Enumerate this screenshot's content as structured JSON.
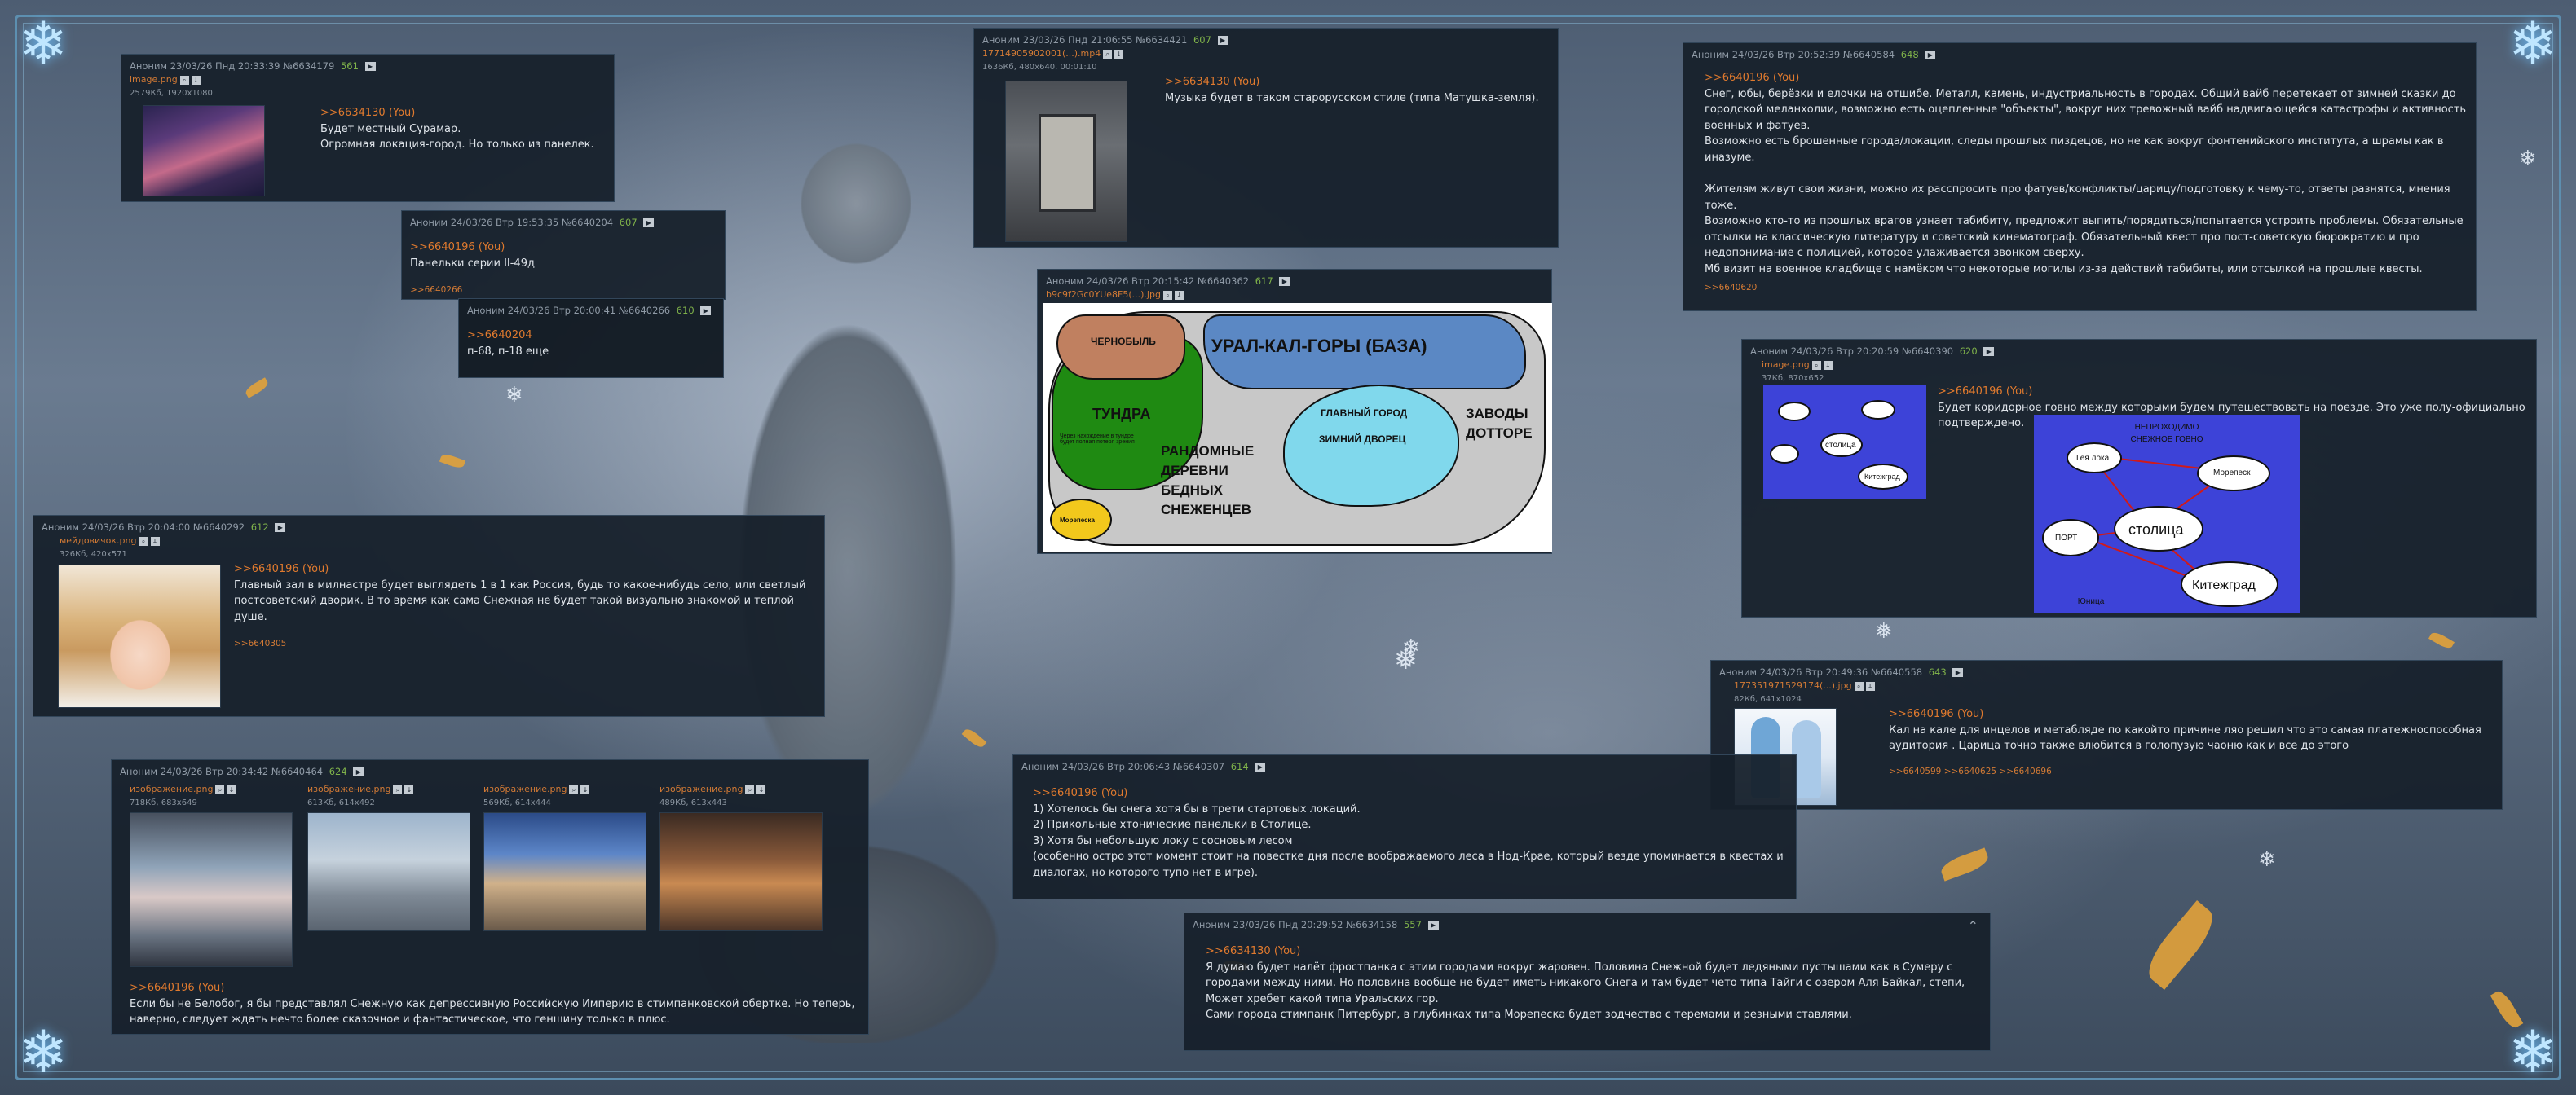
{
  "posts": {
    "p1": {
      "header": "Аноним 23/03/26 Пнд 20:33:39 №6634179",
      "count": "561",
      "file_name": "image.png",
      "file_meta": "2579Кб, 1920x1080",
      "reply_to": ">>6634130 (You)",
      "lines": [
        "Будет местный Сурамар.",
        "Огромная локация-город. Но только из панелек."
      ]
    },
    "p2": {
      "header": "Аноним 24/03/26 Втр 19:53:35 №6640204",
      "count": "607",
      "reply_to": ">>6640196 (You)",
      "lines": [
        "Панельки серии II-49д"
      ],
      "backrefs": ">>6640266"
    },
    "p3": {
      "header": "Аноним 24/03/26 Втр 20:00:41 №6640266",
      "count": "610",
      "reply_to": ">>6640204",
      "lines": [
        "п-68, п-18 еще"
      ]
    },
    "p4": {
      "header": "Аноним 23/03/26 Пнд 21:06:55 №6634421",
      "count": "607",
      "file_name": "17714905902001(...).mp4",
      "file_meta": "1636Кб, 480x640, 00:01:10",
      "reply_to": ">>6634130 (You)",
      "lines": [
        "Музыка будет в таком старорусском стиле (типа Матушка-земля)."
      ]
    },
    "p5": {
      "header": "Аноним 24/03/26 Втр 20:15:42 №6640362",
      "count": "617",
      "file_name": "b9c9f2Gc0YUe8F5(...).jpg",
      "map": {
        "chernobyl": "ЧЕРНОБЫЛЬ",
        "ural": "УРАЛ-КАЛ-ГОРЫ (БАЗА)",
        "tundra": "ТУНДРА",
        "tundra_note": "Через нахождение в тундре будет полная потеря зрения",
        "villages": [
          "РАНДОМНЫЕ",
          "ДЕРЕВНИ",
          "БЕДНЫХ",
          "СНЕЖЕНЦЕВ"
        ],
        "capital": "ГЛАВНЫЙ ГОРОД",
        "palace": "ЗИМНИЙ ДВОРЕЦ",
        "factories": [
          "ЗАВОДЫ",
          "ДОТТОРЕ"
        ],
        "morepeska": "Морепеска"
      }
    },
    "p6": {
      "header": "Аноним 24/03/26 Втр 20:52:39 №6640584",
      "count": "648",
      "reply_to": ">>6640196 (You)",
      "paragraphs": [
        "Снег, юбы, берёзки и елочки на отшибе. Металл, камень, индустриальность в городах. Общий вайб перетекает от зимней сказки до городской меланхолии, возможно есть оцепленные \"объекты\", вокруг них тревожный вайб надвигающейся катастрофы и активность военных и фатуев.",
        "Возможно есть брошенные города/локации, следы прошлых пиздецов, но не как вокруг фонтенийского института, а шрамы как в иназуме.",
        "",
        "Жителям живут свои жизни, можно их расспросить про фатуев/конфликты/царицу/подготовку к чему-то, ответы разнятся, мнения тоже.",
        "Возможно кто-то из прошлых врагов узнает табибиту, предложит выпить/порядиться/попытается устроить проблемы. Обязательные отсылки на классическую литературу и советский кинематограф. Обязательный квест про пост-советскую бюрократию и про недопонимание с полицией, которое улаживается звонком сверху.",
        "Мб визит на военное кладбище с намёком что некоторые могилы из-за действий табибиты, или отсылкой на прошлые квесты."
      ],
      "backrefs": ">>6640620"
    },
    "p7": {
      "header": "Аноним 24/03/26 Втр 20:20:59 №6640390",
      "count": "620",
      "file_name": "image.png",
      "file_meta": "37Кб, 870x652",
      "reply_to": ">>6640196 (You)",
      "lines": [
        "Будет коридорное говно между которыми будем путешествовать на поезде. Это уже полу-официально подтверждено."
      ],
      "route": {
        "top_note": "НЕПРОХОДИМО СНЕЖНОЕ ГОВНО",
        "cities": [
          "Гея лока",
          "Морепеск",
          "столица",
          "ПОРТ",
          "Китежград"
        ],
        "bottom_note": "Юница"
      }
    },
    "p8": {
      "header": "Аноним 24/03/26 Втр 20:04:00 №6640292",
      "count": "612",
      "file_name": "мейдовичок.png",
      "file_meta": "326Кб, 420x571",
      "reply_to": ">>6640196 (You)",
      "lines": [
        "Главный зал в милнастре будет выглядеть 1 в 1 как Россия, будь то какое-нибудь село, или светлый постсоветский дворик. В то время как сама Снежная не будет такой визуально знакомой и теплой душе."
      ],
      "backrefs": ">>6640305"
    },
    "p9": {
      "header": "Аноним 24/03/26 Втр 20:49:36 №6640558",
      "count": "643",
      "file_name": "177351971529174(...).jpg",
      "file_meta": "82Кб, 641x1024",
      "reply_to": ">>6640196 (You)",
      "lines": [
        "Кал на кале для инцелов и метабляде по какойто причине ляо решил что это самая платежноспособная аудитория . Царица точно также влюбится в голопузую чаоню как и все до этого"
      ],
      "backrefs": ">>6640599 >>6640625 >>6640696"
    },
    "p10": {
      "header": "Аноним 24/03/26 Втр 20:34:42 №6640464",
      "count": "624",
      "files": [
        {
          "name": "изображение.png",
          "meta": "718Кб, 683x649"
        },
        {
          "name": "изображение.png",
          "meta": "613Кб, 614x492"
        },
        {
          "name": "изображение.png",
          "meta": "569Кб, 614x444"
        },
        {
          "name": "изображение.png",
          "meta": "489Кб, 613x443"
        }
      ],
      "reply_to": ">>6640196 (You)",
      "lines": [
        "Если бы не Белобог, я бы представлял Снежную как депрессивную Российскую Империю в стимпанковской обертке. Но теперь, наверно, следует ждать нечто более сказочное и фантастическое, что геншину только в плюс."
      ]
    },
    "p11": {
      "header": "Аноним 24/03/26 Втр 20:06:43 №6640307",
      "count": "614",
      "reply_to": ">>6640196 (You)",
      "lines": [
        "1) Хотелось бы снега хотя бы в трети стартовых локаций.",
        "2) Прикольные хтонические панельки в Столице.",
        "3) Хотя бы небольшую локу с сосновым лесом",
        "(особенно остро этот момент стоит на повестке дня после воображаемого леса в Нод-Крае, который везде упоминается в квестах и диалогах, но которого тупо нет в игре)."
      ]
    },
    "p12": {
      "header": "Аноним 23/03/26 Пнд 20:29:52 №6634158",
      "count": "557",
      "reply_to": ">>6634130 (You)",
      "lines": [
        "Я думаю будет налёт фростпанка с этим городами вокруг жаровен. Половина Снежной будет ледяными пустышами как в Сумеру с городами между ними. Но половина вообще не будет иметь никакого Снега и там будет чето типа Тайги с озером Аля Байкал, степи,",
        "Может хребет какой типа Уральских гор.",
        "Сами города стимпанк Питербург, в глубинках типа Морепеска будет зодчество с теремами и резными ставлями."
      ]
    }
  }
}
